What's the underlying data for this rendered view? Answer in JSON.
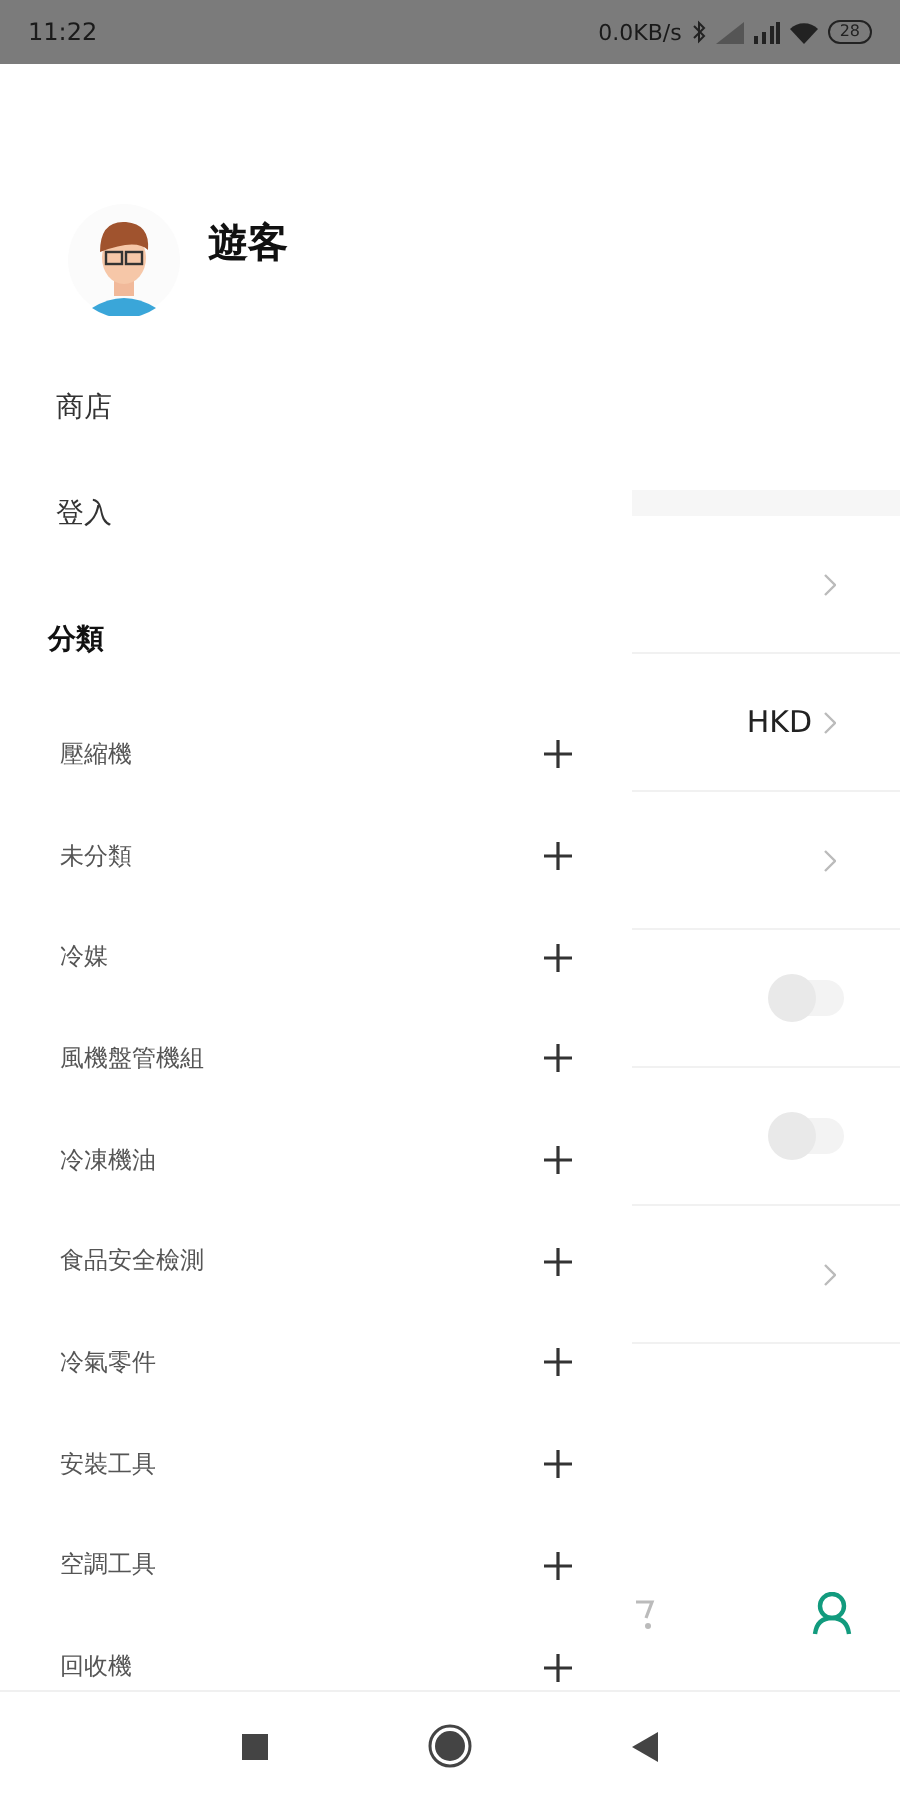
{
  "status_bar": {
    "time": "11:22",
    "speed": "0.0KB/s",
    "battery": "28"
  },
  "drawer": {
    "user_name": "遊客",
    "links": [
      {
        "label": "商店"
      },
      {
        "label": "登入"
      }
    ],
    "section_title": "分類",
    "categories": [
      {
        "label": "壓縮機"
      },
      {
        "label": "未分類"
      },
      {
        "label": "冷媒"
      },
      {
        "label": "風機盤管機組"
      },
      {
        "label": "冷凍機油"
      },
      {
        "label": "食品安全檢測"
      },
      {
        "label": "冷氣零件"
      },
      {
        "label": "安裝工具"
      },
      {
        "label": "空調工具"
      },
      {
        "label": "回收機"
      }
    ]
  },
  "settings_rows": [
    {
      "kind": "link"
    },
    {
      "kind": "link",
      "value": "HKD"
    },
    {
      "kind": "link"
    },
    {
      "kind": "toggle",
      "on": false
    },
    {
      "kind": "toggle",
      "on": false
    },
    {
      "kind": "link"
    }
  ],
  "bottom_tabs": [
    {
      "selected": false
    },
    {
      "selected": true
    }
  ]
}
